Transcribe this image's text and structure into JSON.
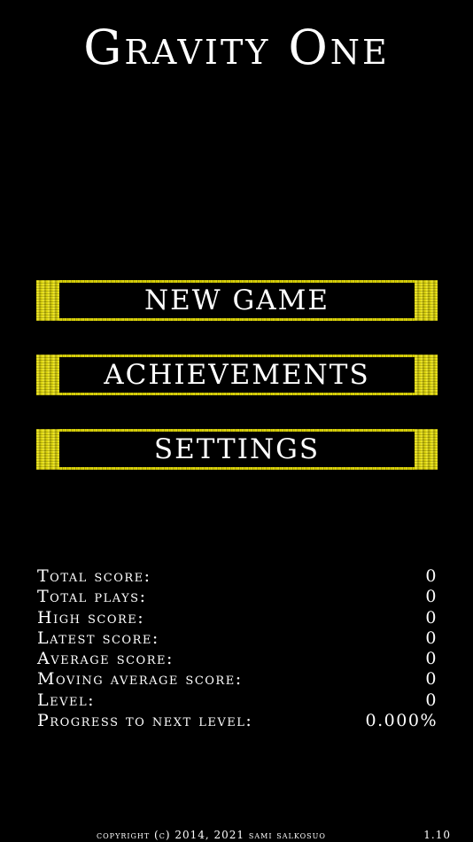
{
  "title": "Gravity One",
  "menu": {
    "new_game": "NEW GAME",
    "achievements": "ACHIEVEMENTS",
    "settings": "SETTINGS"
  },
  "stats": [
    {
      "label": "Total score:",
      "value": "0"
    },
    {
      "label": "Total plays:",
      "value": "0"
    },
    {
      "label": "High score:",
      "value": "0"
    },
    {
      "label": "Latest score:",
      "value": "0"
    },
    {
      "label": "Average score:",
      "value": "0"
    },
    {
      "label": "Moving average score:",
      "value": "0"
    },
    {
      "label": "Level:",
      "value": "0"
    },
    {
      "label": "Progress to next level:",
      "value": "0.000%"
    }
  ],
  "footer": {
    "copyright": "copyright (c) 2014, 2021 sami salkosuo",
    "version": "1.10"
  },
  "colors": {
    "background": "#000000",
    "accent": "#e8e000",
    "text": "#ffffff"
  }
}
